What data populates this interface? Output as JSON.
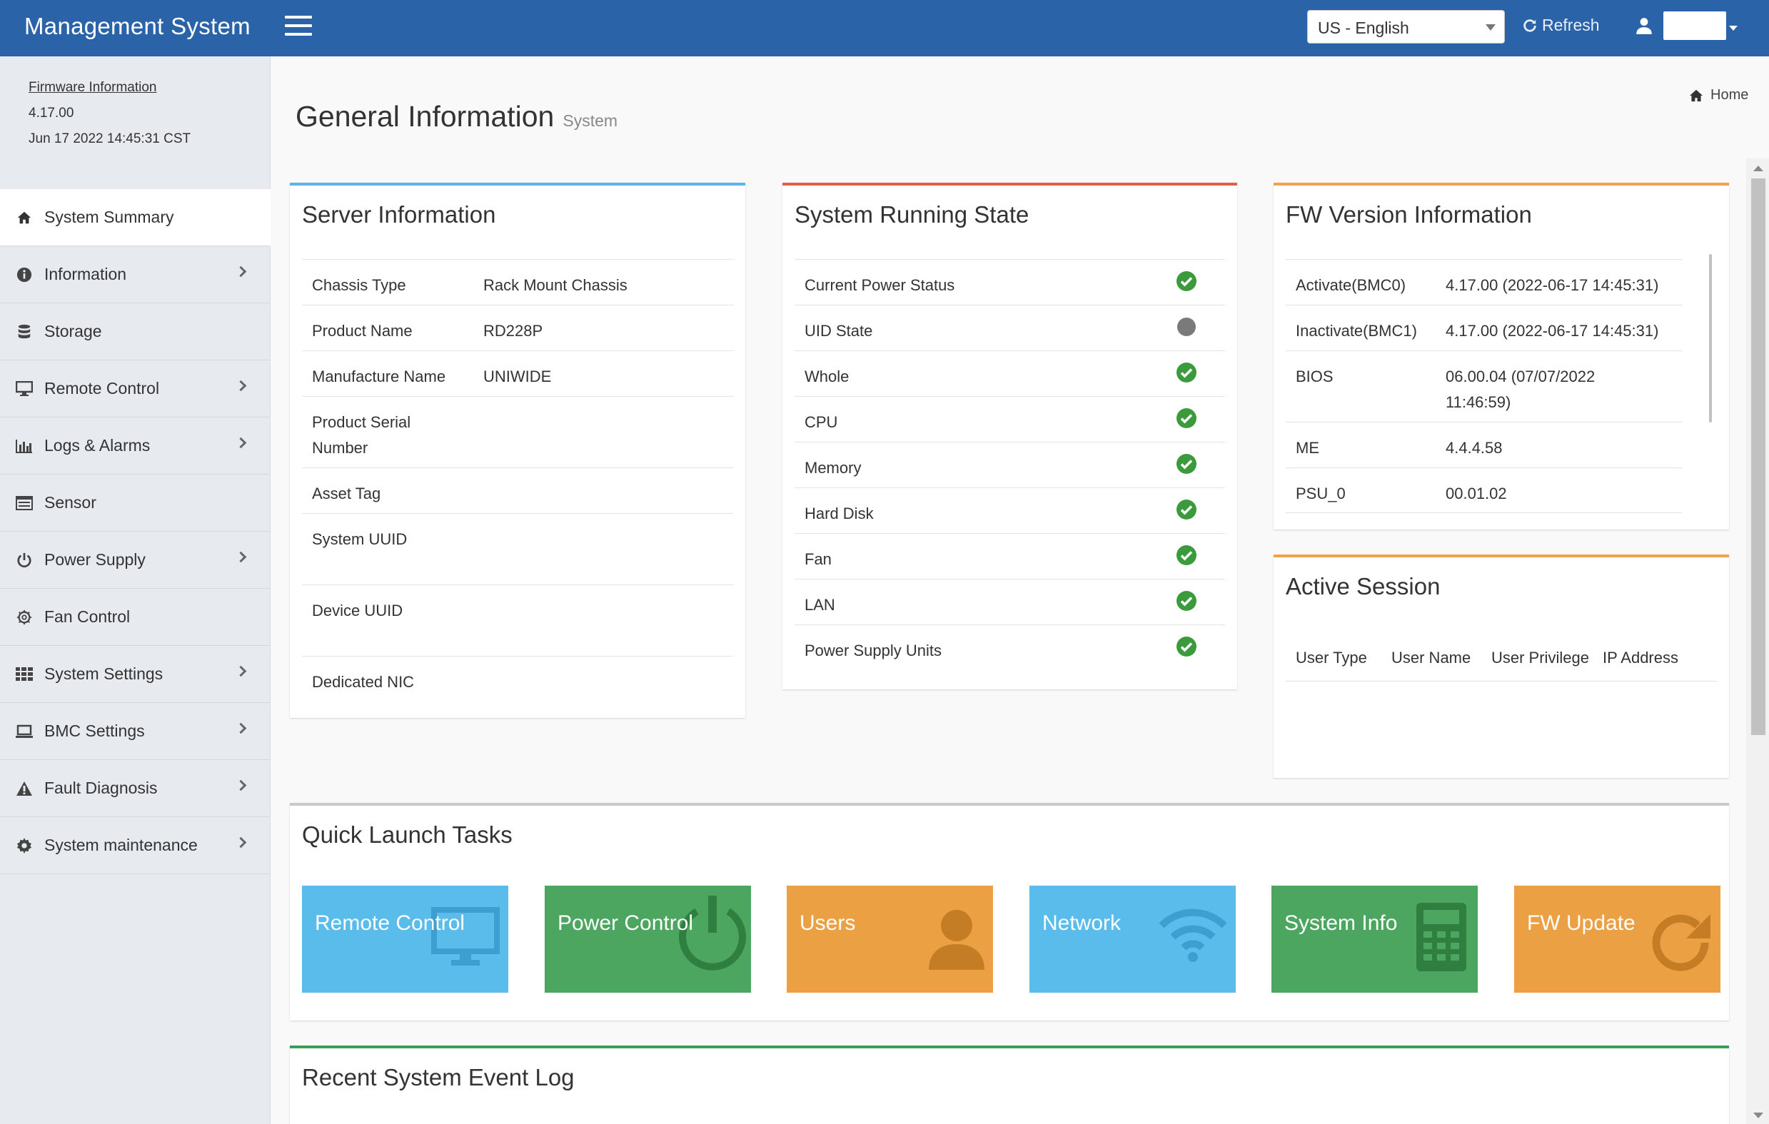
{
  "header": {
    "app_title": "Management System",
    "language": "US - English",
    "refresh_label": "Refresh"
  },
  "sidebar": {
    "firmware_title": "Firmware Information",
    "firmware_version": "4.17.00",
    "firmware_date": "Jun 17 2022 14:45:31 CST",
    "items": [
      {
        "label": "System Summary",
        "icon": "home-icon",
        "has_submenu": false,
        "active": true
      },
      {
        "label": "Information",
        "icon": "info-icon",
        "has_submenu": true
      },
      {
        "label": "Storage",
        "icon": "database-icon",
        "has_submenu": false
      },
      {
        "label": "Remote Control",
        "icon": "monitor-icon",
        "has_submenu": true
      },
      {
        "label": "Logs & Alarms",
        "icon": "bar-chart-icon",
        "has_submenu": true
      },
      {
        "label": "Sensor",
        "icon": "list-icon",
        "has_submenu": false
      },
      {
        "label": "Power Supply",
        "icon": "power-icon",
        "has_submenu": true
      },
      {
        "label": "Fan Control",
        "icon": "fan-icon",
        "has_submenu": false
      },
      {
        "label": "System Settings",
        "icon": "grid-icon",
        "has_submenu": true
      },
      {
        "label": "BMC Settings",
        "icon": "laptop-icon",
        "has_submenu": true
      },
      {
        "label": "Fault Diagnosis",
        "icon": "warning-icon",
        "has_submenu": true
      },
      {
        "label": "System maintenance",
        "icon": "gear-icon",
        "has_submenu": true
      }
    ]
  },
  "page": {
    "title": "General Information",
    "subtitle": "System",
    "breadcrumb": "Home"
  },
  "server_info": {
    "title": "Server Information",
    "rows": [
      {
        "key": "Chassis Type",
        "value": "Rack Mount Chassis"
      },
      {
        "key": "Product Name",
        "value": "RD228P"
      },
      {
        "key": "Manufacture Name",
        "value": "UNIWIDE"
      },
      {
        "key": "Product Serial Number",
        "value": ""
      },
      {
        "key": "Asset Tag",
        "value": ""
      },
      {
        "key": "System UUID",
        "value": ""
      },
      {
        "key": "Device UUID",
        "value": ""
      },
      {
        "key": "Dedicated NIC",
        "value": ""
      }
    ]
  },
  "running_state": {
    "title": "System Running State",
    "rows": [
      {
        "key": "Current Power Status",
        "status": "ok"
      },
      {
        "key": "UID State",
        "status": "off"
      },
      {
        "key": "Whole",
        "status": "ok"
      },
      {
        "key": "CPU",
        "status": "ok"
      },
      {
        "key": "Memory",
        "status": "ok"
      },
      {
        "key": "Hard Disk",
        "status": "ok"
      },
      {
        "key": "Fan",
        "status": "ok"
      },
      {
        "key": "LAN",
        "status": "ok"
      },
      {
        "key": "Power Supply Units",
        "status": "ok"
      }
    ]
  },
  "fw_version": {
    "title": "FW Version Information",
    "rows": [
      {
        "key": "Activate(BMC0)",
        "value": "4.17.00 (2022-06-17 14:45:31)"
      },
      {
        "key": "Inactivate(BMC1)",
        "value": "4.17.00 (2022-06-17 14:45:31)"
      },
      {
        "key": "BIOS",
        "value": "06.00.04 (07/07/2022",
        "value2": "11:46:59)"
      },
      {
        "key": "ME",
        "value": "4.4.4.58"
      },
      {
        "key": "PSU_0",
        "value": "00.01.02"
      }
    ]
  },
  "active_session": {
    "title": "Active Session",
    "columns": [
      "User Type",
      "User Name",
      "User Privilege",
      "IP Address"
    ]
  },
  "quick_launch": {
    "title": "Quick Launch Tasks",
    "tiles": [
      {
        "label": "Remote Control",
        "icon": "monitor-icon",
        "color": "#59bcea"
      },
      {
        "label": "Power Control",
        "icon": "power-icon",
        "color": "#4da65f"
      },
      {
        "label": "Users",
        "icon": "user-icon",
        "color": "#eba043"
      },
      {
        "label": "Network",
        "icon": "wifi-icon",
        "color": "#59bcea"
      },
      {
        "label": "System Info",
        "icon": "calculator-icon",
        "color": "#4da65f"
      },
      {
        "label": "FW Update",
        "icon": "refresh-icon",
        "color": "#eba043"
      }
    ]
  },
  "event_log": {
    "title": "Recent System Event Log"
  }
}
